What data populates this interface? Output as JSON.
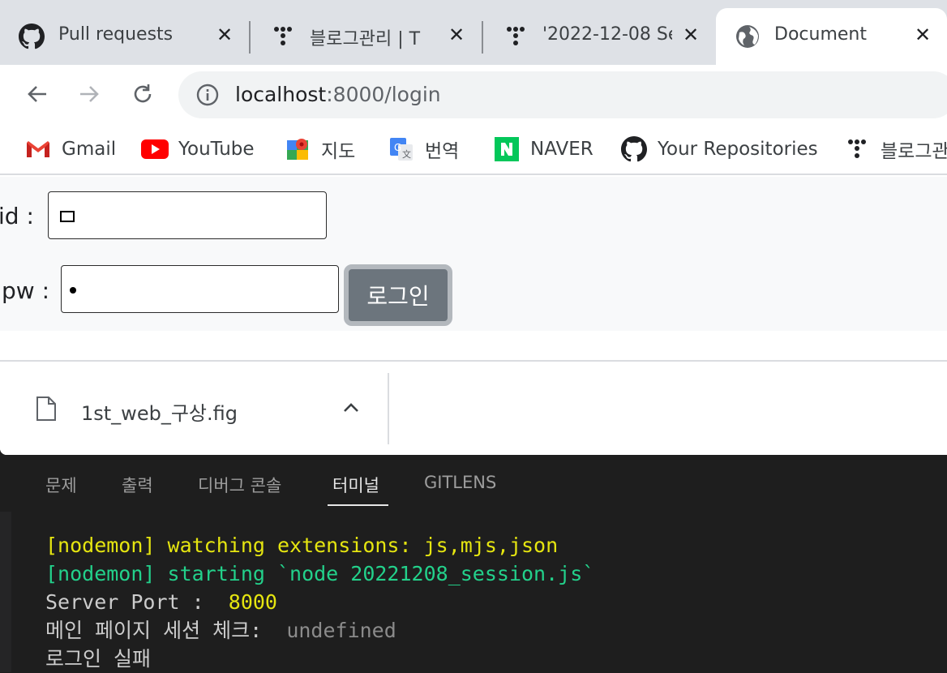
{
  "tabs": [
    {
      "title": "Pull requests · ",
      "icon": "github-icon",
      "active": false
    },
    {
      "title": "블로그관리 | T",
      "icon": "tistory-icon",
      "active": false
    },
    {
      "title": "'2022-12-08 Se",
      "icon": "tistory-icon",
      "active": false
    },
    {
      "title": "Document",
      "icon": "globe-icon",
      "active": true
    }
  ],
  "address_bar": {
    "host": "localhost",
    "path": ":8000/login"
  },
  "bookmarks": [
    {
      "label": "Gmail",
      "icon": "gmail-icon"
    },
    {
      "label": "YouTube",
      "icon": "youtube-icon"
    },
    {
      "label": "지도",
      "icon": "maps-icon"
    },
    {
      "label": "번역",
      "icon": "translate-icon"
    },
    {
      "label": "NAVER",
      "icon": "naver-icon"
    },
    {
      "label": "Your Repositories",
      "icon": "github-icon"
    },
    {
      "label": "블로그관",
      "icon": "tistory-icon"
    }
  ],
  "form": {
    "id_label": "id :",
    "pw_label": "pw :",
    "login_button": "로그인"
  },
  "download": {
    "file_name": "1st_web_구상.fig"
  },
  "panel_tabs": [
    "문제",
    "출력",
    "디버그 콘솔",
    "터미널",
    "GITLENS"
  ],
  "terminal": {
    "line1": "[nodemon] watching extensions: js,mjs,json",
    "line2": "[nodemon] starting `node 20221208_session.js`",
    "line3_label": "Server Port :  ",
    "line3_value": "8000",
    "line4_label": "메인 페이지 세션 체크:  ",
    "line4_value": "undefined",
    "line5": "로그인 실패"
  },
  "colors": {
    "terminal_yellow": "#e5e510",
    "terminal_green": "#23d18b",
    "button": "#6c757d"
  }
}
